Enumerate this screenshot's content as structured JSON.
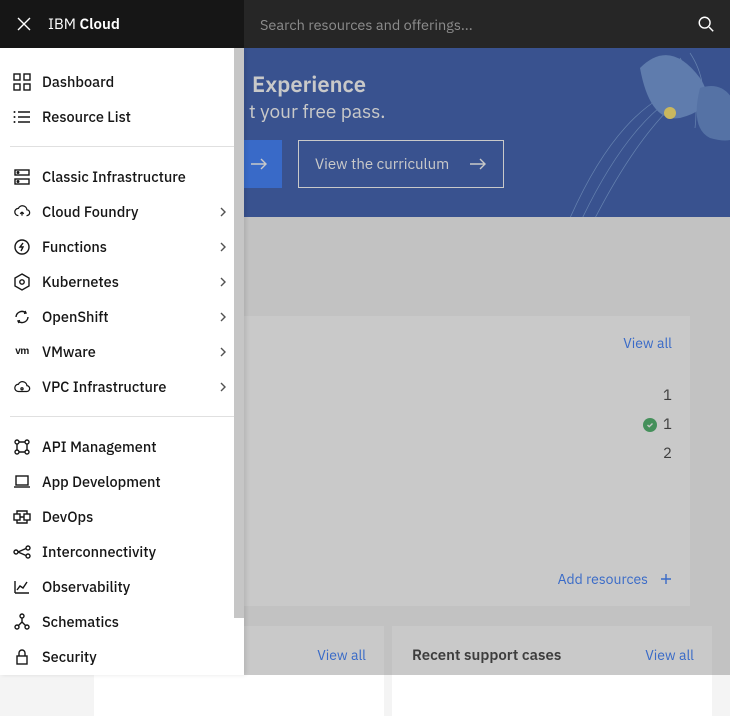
{
  "topbar": {
    "brand_prefix": "IBM ",
    "brand_bold": "Cloud",
    "search_placeholder": "Search resources and offerings..."
  },
  "sidebar": {
    "groupA": [
      {
        "label": "Dashboard",
        "icon": "dashboard",
        "chev": false
      },
      {
        "label": "Resource List",
        "icon": "list",
        "chev": false
      }
    ],
    "groupB": [
      {
        "label": "Classic Infrastructure",
        "icon": "server",
        "chev": false
      },
      {
        "label": "Cloud Foundry",
        "icon": "cloud-up",
        "chev": true
      },
      {
        "label": "Functions",
        "icon": "bolt",
        "chev": true
      },
      {
        "label": "Kubernetes",
        "icon": "hex",
        "chev": true
      },
      {
        "label": "OpenShift",
        "icon": "cycle",
        "chev": true
      },
      {
        "label": "VMware",
        "icon": "vm",
        "chev": true
      },
      {
        "label": "VPC Infrastructure",
        "icon": "cloud",
        "chev": true
      }
    ],
    "groupC": [
      {
        "label": "API Management",
        "icon": "api",
        "chev": false
      },
      {
        "label": "App Development",
        "icon": "laptop",
        "chev": false
      },
      {
        "label": "DevOps",
        "icon": "devops",
        "chev": false
      },
      {
        "label": "Interconnectivity",
        "icon": "connect",
        "chev": false
      },
      {
        "label": "Observability",
        "icon": "chart",
        "chev": false
      },
      {
        "label": "Schematics",
        "icon": "schema",
        "chev": false
      },
      {
        "label": "Security",
        "icon": "lock",
        "chev": false
      }
    ]
  },
  "hero": {
    "title_fragment": "Experience",
    "subtitle_fragment": "t your free pass.",
    "outline_btn": "View the curriculum"
  },
  "cards": {
    "view_all": "View all",
    "add_resources": "Add resources",
    "recent_support": "Recent support cases",
    "values": [
      "1",
      "1",
      "2"
    ]
  }
}
